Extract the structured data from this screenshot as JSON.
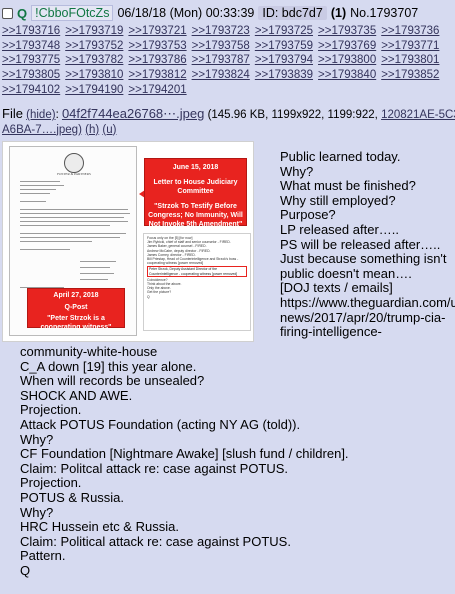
{
  "post": {
    "icon_names": [
      "checkbox-icon"
    ],
    "name": "Q",
    "trip": "!CbboFOtcZs",
    "date": "06/18/18 (Mon) 00:33:39",
    "id_label": "ID: bdc7d7",
    "reply_count": "(1)",
    "post_no": "No.1793707",
    "replies": [
      ">>1793716",
      ">>1793719",
      ">>1793721",
      ">>1793723",
      ">>1793725",
      ">>1793735",
      ">>1793736",
      ">>1793748",
      ">>1793752",
      ">>1793753",
      ">>1793758",
      ">>1793759",
      ">>1793769",
      ">>1793771",
      ">>1793775",
      ">>1793782",
      ">>1793786",
      ">>1793787",
      ">>1793794",
      ">>1793800",
      ">>1793801",
      ">>1793805",
      ">>1793810",
      ">>1793812",
      ">>1793824",
      ">>1793839",
      ">>1793840",
      ">>1793852",
      ">>1794102",
      ">>1794190",
      ">>1794201"
    ],
    "file": {
      "label": "File",
      "hide": "(hide)",
      "filename": "04f2f744ea26768⋯.jpeg",
      "meta": "(145.96 KB, 1199x922, 1199:922,",
      "original_name": "120821AE-5C3A-40",
      "original_name_cont": "A6BA-7….jpeg)",
      "h_link": "(h)",
      "u_link": "(u)"
    },
    "image": {
      "seal_caption": "FOSTER & PARTNERS",
      "callout_top_date": "June 15, 2018",
      "callout_top_sub": "Letter to House Judiciary Committee",
      "callout_top_quote": "\"Strzok To Testify Before Congress; No Immunity, Will Not Invoke 5th Amendment\"",
      "callout_bottom_date": "April 27, 2018",
      "callout_bottom_sub": "Q-Post",
      "callout_bottom_quote": "\"Peter Strzok is a cooperating witness\"",
      "tweet_lines": [
        "Focus only on the [5] [for now]",
        "Jim Rybicki, chief of staff and senior counselor - FIRED.",
        "James Baker, general counsel - FIRED.",
        "Andrew McCabe, deputy director - FIRED.",
        "James Comey, director - FIRED.",
        "Bill Priestap, Head of Counterintelligence and Strzok's boss - cooperating witness [power removed]"
      ],
      "tweet_highlight": "Peter Strzok, Deputy Assistant Director of the Counterintelligence - cooperating witness [power removed]",
      "tweet_tail": [
        "Coincidence?",
        "Think about the above.",
        "Only the above.",
        "Get the picture?",
        "Q"
      ]
    },
    "body_right": "Public learned today.\nWhy?\nWhat must be finished?\nWhy still employed?\nPurpose?\nLP released after…..\nPS will be released after…..\nJust because something isn't public doesn't mean….\n[DOJ texts / emails]\nhttps://www.theguardian.com/us-news/2017/apr/20/trump-cia-firing-intelligence-",
    "body_bottom": "community-white-house\nC_A down [19] this year alone.\nWhen will records be unsealed?\nSHOCK AND AWE.\nProjection.\nAttack POTUS Foundation (acting NY AG (told)).\nWhy?\nCF Foundation [Nightmare Awake] [slush fund / children].\nClaim: Politcal attack re: case against POTUS.\nProjection.\nPOTUS & Russia.\nWhy?\nHRC Hussein etc & Russia.\nClaim: Political attack re: case against POTUS.\nPattern.\nQ",
    "colors": {
      "background": "#d6daf0",
      "name": "#117743",
      "link": "#34345c",
      "callout": "#e8231f"
    }
  }
}
